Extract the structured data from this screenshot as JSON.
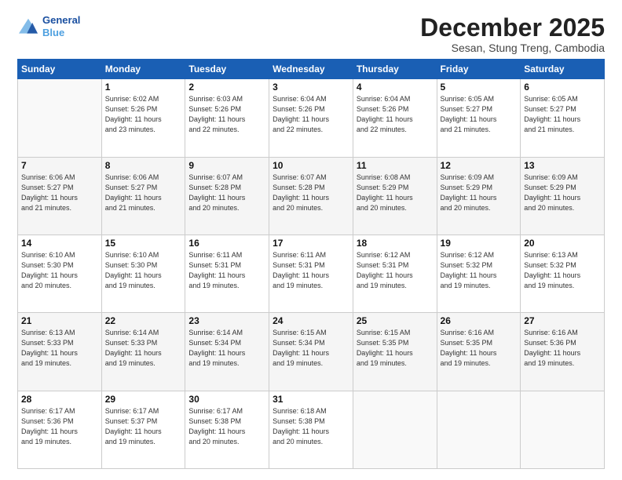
{
  "logo": {
    "line1": "General",
    "line2": "Blue"
  },
  "title": "December 2025",
  "subtitle": "Sesan, Stung Treng, Cambodia",
  "headers": [
    "Sunday",
    "Monday",
    "Tuesday",
    "Wednesday",
    "Thursday",
    "Friday",
    "Saturday"
  ],
  "weeks": [
    [
      {
        "day": "",
        "info": ""
      },
      {
        "day": "1",
        "info": "Sunrise: 6:02 AM\nSunset: 5:26 PM\nDaylight: 11 hours\nand 23 minutes."
      },
      {
        "day": "2",
        "info": "Sunrise: 6:03 AM\nSunset: 5:26 PM\nDaylight: 11 hours\nand 22 minutes."
      },
      {
        "day": "3",
        "info": "Sunrise: 6:04 AM\nSunset: 5:26 PM\nDaylight: 11 hours\nand 22 minutes."
      },
      {
        "day": "4",
        "info": "Sunrise: 6:04 AM\nSunset: 5:26 PM\nDaylight: 11 hours\nand 22 minutes."
      },
      {
        "day": "5",
        "info": "Sunrise: 6:05 AM\nSunset: 5:27 PM\nDaylight: 11 hours\nand 21 minutes."
      },
      {
        "day": "6",
        "info": "Sunrise: 6:05 AM\nSunset: 5:27 PM\nDaylight: 11 hours\nand 21 minutes."
      }
    ],
    [
      {
        "day": "7",
        "info": "Sunrise: 6:06 AM\nSunset: 5:27 PM\nDaylight: 11 hours\nand 21 minutes."
      },
      {
        "day": "8",
        "info": "Sunrise: 6:06 AM\nSunset: 5:27 PM\nDaylight: 11 hours\nand 21 minutes."
      },
      {
        "day": "9",
        "info": "Sunrise: 6:07 AM\nSunset: 5:28 PM\nDaylight: 11 hours\nand 20 minutes."
      },
      {
        "day": "10",
        "info": "Sunrise: 6:07 AM\nSunset: 5:28 PM\nDaylight: 11 hours\nand 20 minutes."
      },
      {
        "day": "11",
        "info": "Sunrise: 6:08 AM\nSunset: 5:29 PM\nDaylight: 11 hours\nand 20 minutes."
      },
      {
        "day": "12",
        "info": "Sunrise: 6:09 AM\nSunset: 5:29 PM\nDaylight: 11 hours\nand 20 minutes."
      },
      {
        "day": "13",
        "info": "Sunrise: 6:09 AM\nSunset: 5:29 PM\nDaylight: 11 hours\nand 20 minutes."
      }
    ],
    [
      {
        "day": "14",
        "info": "Sunrise: 6:10 AM\nSunset: 5:30 PM\nDaylight: 11 hours\nand 20 minutes."
      },
      {
        "day": "15",
        "info": "Sunrise: 6:10 AM\nSunset: 5:30 PM\nDaylight: 11 hours\nand 19 minutes."
      },
      {
        "day": "16",
        "info": "Sunrise: 6:11 AM\nSunset: 5:31 PM\nDaylight: 11 hours\nand 19 minutes."
      },
      {
        "day": "17",
        "info": "Sunrise: 6:11 AM\nSunset: 5:31 PM\nDaylight: 11 hours\nand 19 minutes."
      },
      {
        "day": "18",
        "info": "Sunrise: 6:12 AM\nSunset: 5:31 PM\nDaylight: 11 hours\nand 19 minutes."
      },
      {
        "day": "19",
        "info": "Sunrise: 6:12 AM\nSunset: 5:32 PM\nDaylight: 11 hours\nand 19 minutes."
      },
      {
        "day": "20",
        "info": "Sunrise: 6:13 AM\nSunset: 5:32 PM\nDaylight: 11 hours\nand 19 minutes."
      }
    ],
    [
      {
        "day": "21",
        "info": "Sunrise: 6:13 AM\nSunset: 5:33 PM\nDaylight: 11 hours\nand 19 minutes."
      },
      {
        "day": "22",
        "info": "Sunrise: 6:14 AM\nSunset: 5:33 PM\nDaylight: 11 hours\nand 19 minutes."
      },
      {
        "day": "23",
        "info": "Sunrise: 6:14 AM\nSunset: 5:34 PM\nDaylight: 11 hours\nand 19 minutes."
      },
      {
        "day": "24",
        "info": "Sunrise: 6:15 AM\nSunset: 5:34 PM\nDaylight: 11 hours\nand 19 minutes."
      },
      {
        "day": "25",
        "info": "Sunrise: 6:15 AM\nSunset: 5:35 PM\nDaylight: 11 hours\nand 19 minutes."
      },
      {
        "day": "26",
        "info": "Sunrise: 6:16 AM\nSunset: 5:35 PM\nDaylight: 11 hours\nand 19 minutes."
      },
      {
        "day": "27",
        "info": "Sunrise: 6:16 AM\nSunset: 5:36 PM\nDaylight: 11 hours\nand 19 minutes."
      }
    ],
    [
      {
        "day": "28",
        "info": "Sunrise: 6:17 AM\nSunset: 5:36 PM\nDaylight: 11 hours\nand 19 minutes."
      },
      {
        "day": "29",
        "info": "Sunrise: 6:17 AM\nSunset: 5:37 PM\nDaylight: 11 hours\nand 19 minutes."
      },
      {
        "day": "30",
        "info": "Sunrise: 6:17 AM\nSunset: 5:38 PM\nDaylight: 11 hours\nand 20 minutes."
      },
      {
        "day": "31",
        "info": "Sunrise: 6:18 AM\nSunset: 5:38 PM\nDaylight: 11 hours\nand 20 minutes."
      },
      {
        "day": "",
        "info": ""
      },
      {
        "day": "",
        "info": ""
      },
      {
        "day": "",
        "info": ""
      }
    ]
  ]
}
